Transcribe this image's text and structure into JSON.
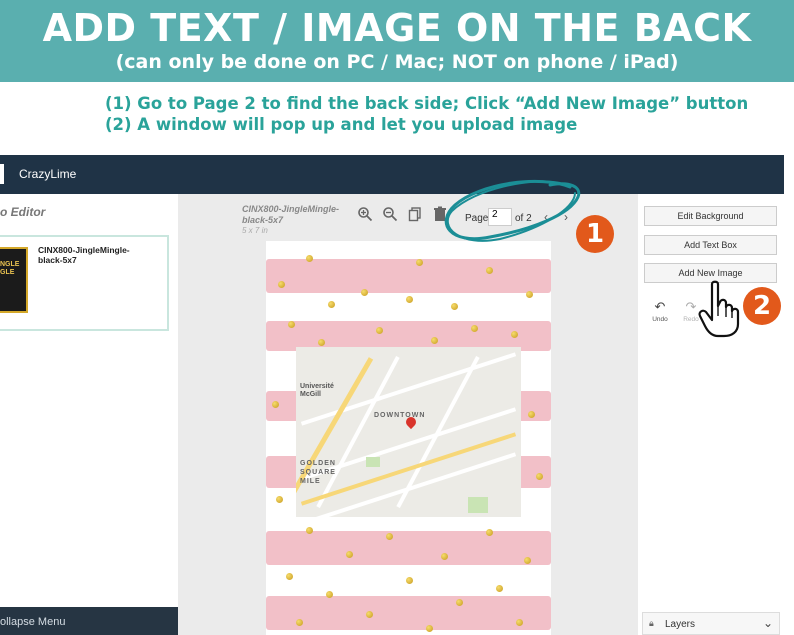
{
  "banner": {
    "title": "ADD TEXT / IMAGE ON THE BACK",
    "subtitle": "(can only be done on PC / Mac; NOT on phone / iPad)"
  },
  "instructions": {
    "line1": "(1) Go to Page 2 to find the back side; Click “Add New Image” button",
    "line2": "(2) A window will pop up and let you upload image"
  },
  "app": {
    "brand": "CrazyLime",
    "left_panel": {
      "title": "o Editor",
      "product_name": "CINX800-JingleMingle-black-5x7",
      "thumb_text": "NGLE GLE",
      "collapse_label": "ollapse Menu"
    },
    "canvas": {
      "doc_name": "CINX800-JingleMingle-black-5x7",
      "doc_size": "5 x 7 in",
      "page_label": "Page",
      "page_value": "2",
      "page_of": "of 2",
      "prev_icon": "chevron-left-icon",
      "next_icon": "chevron-right-icon"
    },
    "map_labels": {
      "university": "Université McGill",
      "downtown": "DOWNTOWN",
      "golden": "GOLDEN SQUARE MILE"
    },
    "right_panel": {
      "edit_background": "Edit Background",
      "add_text_box": "Add Text Box",
      "add_new_image": "Add New Image",
      "undo": "Undo",
      "redo": "Redo",
      "layers": "Layers"
    }
  },
  "annotations": {
    "step1": "1",
    "step2": "2"
  },
  "colors": {
    "banner": "#5aafaf",
    "instruction_text": "#2aa39a",
    "header": "#1f3346",
    "badge": "#e2591b",
    "stripe_pink": "#f2c0c8",
    "circle_teal": "#1b8e96"
  }
}
